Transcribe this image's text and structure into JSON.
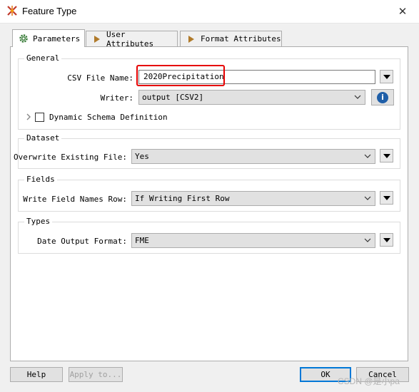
{
  "window": {
    "title": "Feature Type",
    "close_symbol": "✕"
  },
  "tabs": [
    {
      "label": "Parameters",
      "icon": "gear-icon",
      "active": true
    },
    {
      "label": "User Attributes",
      "icon": "arrow-right-icon",
      "active": false
    },
    {
      "label": "Format Attributes",
      "icon": "arrow-right-icon",
      "active": false
    }
  ],
  "general": {
    "legend": "General",
    "csv_file_name_label": "CSV File Name:",
    "csv_file_name_value": "2020Precipitation",
    "writer_label": "Writer:",
    "writer_value": "output [CSV2]",
    "dynamic_schema_label": "Dynamic Schema Definition"
  },
  "dataset": {
    "legend": "Dataset",
    "overwrite_label": "Overwrite Existing File:",
    "overwrite_value": "Yes"
  },
  "fields": {
    "legend": "Fields",
    "write_field_names_label": "Write Field Names Row:",
    "write_field_names_value": "If Writing First Row"
  },
  "types": {
    "legend": "Types",
    "date_output_label": "Date Output Format:",
    "date_output_value": "FME"
  },
  "footer": {
    "help_label": "Help",
    "apply_label": "Apply to...",
    "ok_label": "OK",
    "cancel_label": "Cancel"
  },
  "watermark": "CSDN @是小pa",
  "colors": {
    "highlight": "#e60000",
    "info": "#1f5fa8",
    "ok_border": "#0078d7"
  }
}
